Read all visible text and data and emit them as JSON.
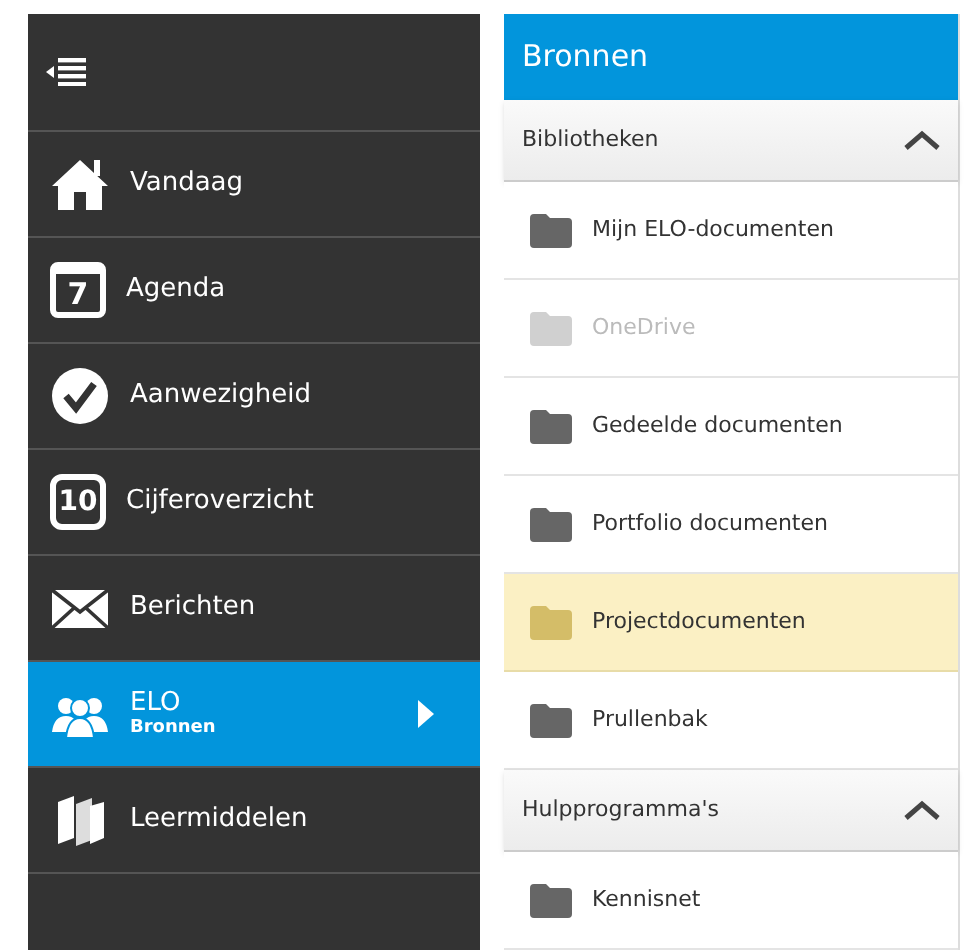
{
  "sidebar": {
    "items": [
      {
        "label": "Vandaag",
        "kind": "home",
        "selected": false
      },
      {
        "label": "Agenda",
        "kind": "calendar",
        "day": "7",
        "selected": false
      },
      {
        "label": "Aanwezigheid",
        "kind": "check",
        "selected": false
      },
      {
        "label": "Cijferoverzicht",
        "kind": "grade",
        "grade": "10",
        "selected": false
      },
      {
        "label": "Berichten",
        "kind": "mail",
        "selected": false
      },
      {
        "label": "ELO",
        "sublabel": "Bronnen",
        "kind": "people",
        "selected": true
      },
      {
        "label": "Leermiddelen",
        "kind": "books",
        "selected": false
      }
    ]
  },
  "panel": {
    "title": "Bronnen",
    "sections": [
      {
        "title": "Bibliotheken",
        "expanded": true,
        "items": [
          {
            "label": "Mijn ELO-documenten",
            "disabled": false,
            "selected": false
          },
          {
            "label": "OneDrive",
            "disabled": true,
            "selected": false
          },
          {
            "label": "Gedeelde documenten",
            "disabled": false,
            "selected": false
          },
          {
            "label": "Portfolio documenten",
            "disabled": false,
            "selected": false
          },
          {
            "label": "Projectdocumenten",
            "disabled": false,
            "selected": true
          },
          {
            "label": "Prullenbak",
            "disabled": false,
            "selected": false
          }
        ]
      },
      {
        "title": "Hulpprogramma's",
        "expanded": true,
        "items": [
          {
            "label": "Kennisnet",
            "disabled": false,
            "selected": false
          }
        ]
      }
    ]
  }
}
